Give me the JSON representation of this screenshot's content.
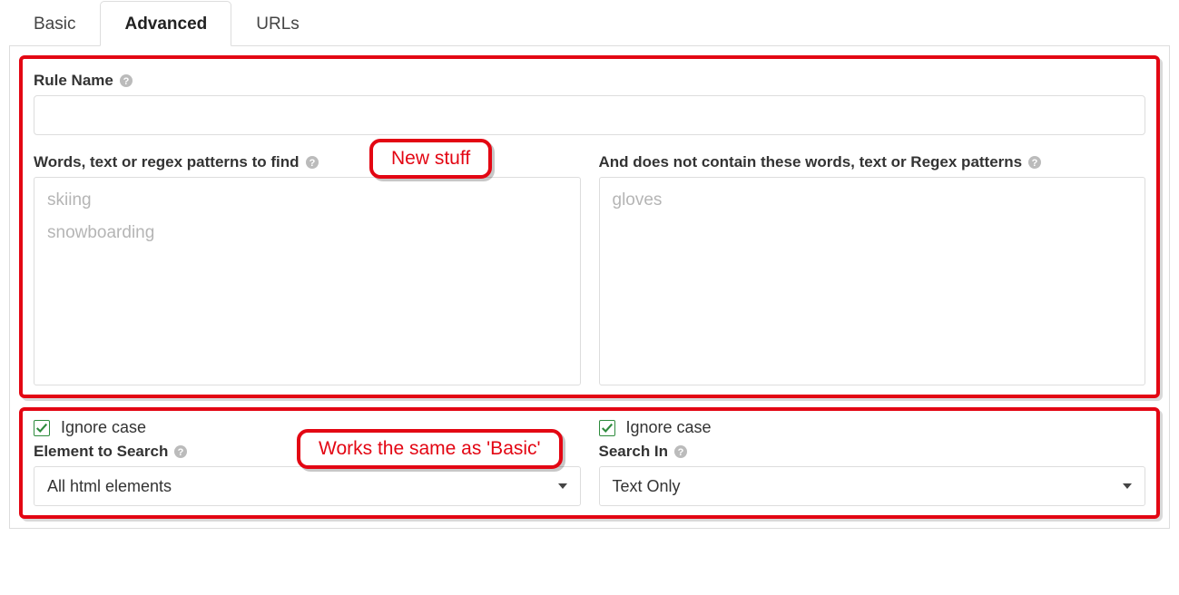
{
  "tabs": {
    "basic": "Basic",
    "advanced": "Advanced",
    "urls": "URLs",
    "active": "advanced"
  },
  "ruleName": {
    "label": "Rule Name",
    "value": ""
  },
  "find": {
    "label": "Words, text or regex patterns to find",
    "tags": [
      "skiing",
      "snowboarding"
    ]
  },
  "exclude": {
    "label": "And does not contain these words, text or Regex patterns",
    "tags": [
      "gloves"
    ]
  },
  "annotations": {
    "top": "New stuff",
    "bottom": "Works the same as 'Basic'"
  },
  "left": {
    "ignoreCaseLabel": "Ignore case",
    "ignoreCaseChecked": true,
    "elementLabel": "Element to Search",
    "elementValue": "All html elements"
  },
  "right": {
    "ignoreCaseLabel": "Ignore case",
    "ignoreCaseChecked": true,
    "searchInLabel": "Search In",
    "searchInValue": "Text Only"
  }
}
